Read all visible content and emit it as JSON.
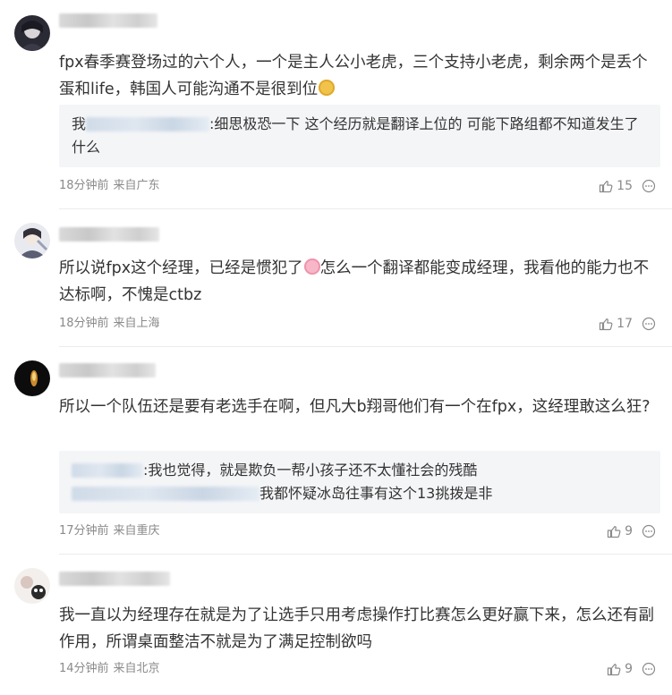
{
  "comments": [
    {
      "text": "fpx春季赛登场过的六个人，一个是主人公小老虎，三个支持小老虎，剩余两个是丢个蛋和life，韩国人可能沟通不是很到位",
      "emoji": "doge-emoji",
      "replies": [
        {
          "prefix": "我",
          "text": ":细思极恐一下 这个经历就是翻译上位的 可能下路组都不知道发生了什么"
        }
      ],
      "time": "18分钟前",
      "location": "来自广东",
      "likes": "15"
    },
    {
      "text_before_emoji": "所以说fpx这个经理，已经是惯犯了",
      "emoji": "pig-emoji",
      "text_after_emoji": "怎么一个翻译都能变成经理，我看他的能力也不达标啊，不愧是ctbz",
      "replies": [],
      "time": "18分钟前",
      "location": "来自上海",
      "likes": "17"
    },
    {
      "text": "所以一个队伍还是要有老选手在啊，但凡大b翔哥他们有一个在fpx，这经理敢这么狂?",
      "replies": [
        {
          "prefix": "",
          "text": ":我也觉得，就是欺负一帮小孩子还不太懂社会的残酷"
        },
        {
          "prefix": "",
          "text": "我都怀疑冰岛往事有这个13挑拨是非"
        }
      ],
      "time": "17分钟前",
      "location": "来自重庆",
      "likes": "9"
    },
    {
      "text": "我一直以为经理存在就是为了让选手只用考虑操作打比赛怎么更好赢下来，怎么还有副作用，所谓桌面整洁不就是为了满足控制欲吗",
      "replies": [],
      "time": "14分钟前",
      "location": "来自北京",
      "likes": "9"
    }
  ],
  "icons": {
    "like": "thumbs-up-icon",
    "more": "more-options-icon"
  },
  "colors": {
    "text": "#333333",
    "meta": "#8a8a8a",
    "reply_bg": "#f4f5f7",
    "divider": "#ececec"
  }
}
